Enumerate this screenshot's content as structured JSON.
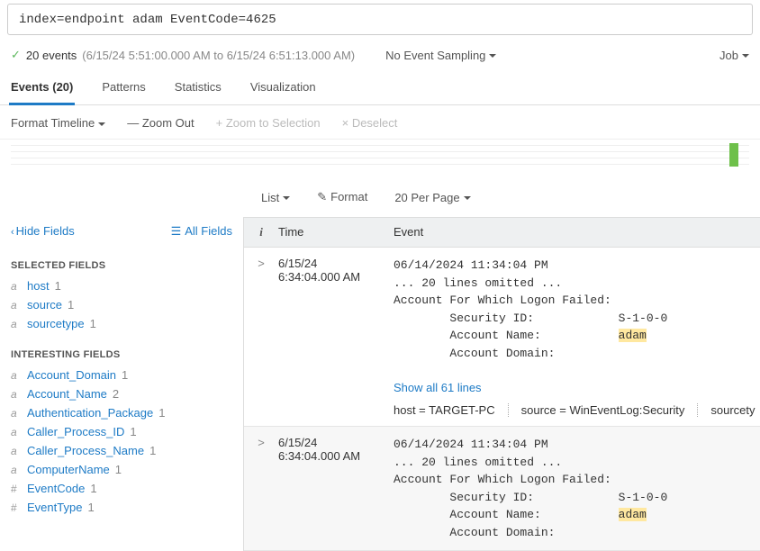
{
  "search": {
    "query": "index=endpoint adam EventCode=4625"
  },
  "status": {
    "count_label": "20 events",
    "range": "(6/15/24 5:51:00.000 AM to 6/15/24 6:51:13.000 AM)",
    "sampling": "No Event Sampling",
    "job": "Job"
  },
  "tabs": {
    "events": "Events (20)",
    "patterns": "Patterns",
    "statistics": "Statistics",
    "visualization": "Visualization"
  },
  "timeline_controls": {
    "format": "Format Timeline",
    "zoom_out": "— Zoom Out",
    "zoom_sel": "+ Zoom to Selection",
    "deselect": "× Deselect"
  },
  "event_controls": {
    "list": "List",
    "format": "Format",
    "per_page": "20 Per Page"
  },
  "fields_panel": {
    "hide": "Hide Fields",
    "all": "All Fields",
    "selected_title": "SELECTED FIELDS",
    "interesting_title": "INTERESTING FIELDS",
    "selected": [
      {
        "type": "a",
        "name": "host",
        "count": "1"
      },
      {
        "type": "a",
        "name": "source",
        "count": "1"
      },
      {
        "type": "a",
        "name": "sourcetype",
        "count": "1"
      }
    ],
    "interesting": [
      {
        "type": "a",
        "name": "Account_Domain",
        "count": "1"
      },
      {
        "type": "a",
        "name": "Account_Name",
        "count": "2"
      },
      {
        "type": "a",
        "name": "Authentication_Package",
        "count": "1"
      },
      {
        "type": "a",
        "name": "Caller_Process_ID",
        "count": "1"
      },
      {
        "type": "a",
        "name": "Caller_Process_Name",
        "count": "1"
      },
      {
        "type": "a",
        "name": "ComputerName",
        "count": "1"
      },
      {
        "type": "#",
        "name": "EventCode",
        "count": "1"
      },
      {
        "type": "#",
        "name": "EventType",
        "count": "1"
      }
    ]
  },
  "events_header": {
    "info": "i",
    "time": "Time",
    "event": "Event"
  },
  "events": [
    {
      "date": "6/15/24",
      "time": "6:34:04.000 AM",
      "ts": "06/14/2024 11:34:04 PM",
      "omitted": "... 20 lines omitted ...",
      "l1": "Account For Which Logon Failed:",
      "l2": "        Security ID:            S-1-0-0",
      "l3a": "        Account Name:           ",
      "l3hl": "adam",
      "l4": "        Account Domain:",
      "show": "Show all 61 lines",
      "meta": {
        "host_k": "host =",
        "host_v": "TARGET-PC",
        "source_k": "source =",
        "source_v": "WinEventLog:Security",
        "st_k": "sourcety"
      }
    },
    {
      "date": "6/15/24",
      "time": "6:34:04.000 AM",
      "ts": "06/14/2024 11:34:04 PM",
      "omitted": "... 20 lines omitted ...",
      "l1": "Account For Which Logon Failed:",
      "l2": "        Security ID:            S-1-0-0",
      "l3a": "        Account Name:           ",
      "l3hl": "adam",
      "l4": "        Account Domain:"
    }
  ]
}
